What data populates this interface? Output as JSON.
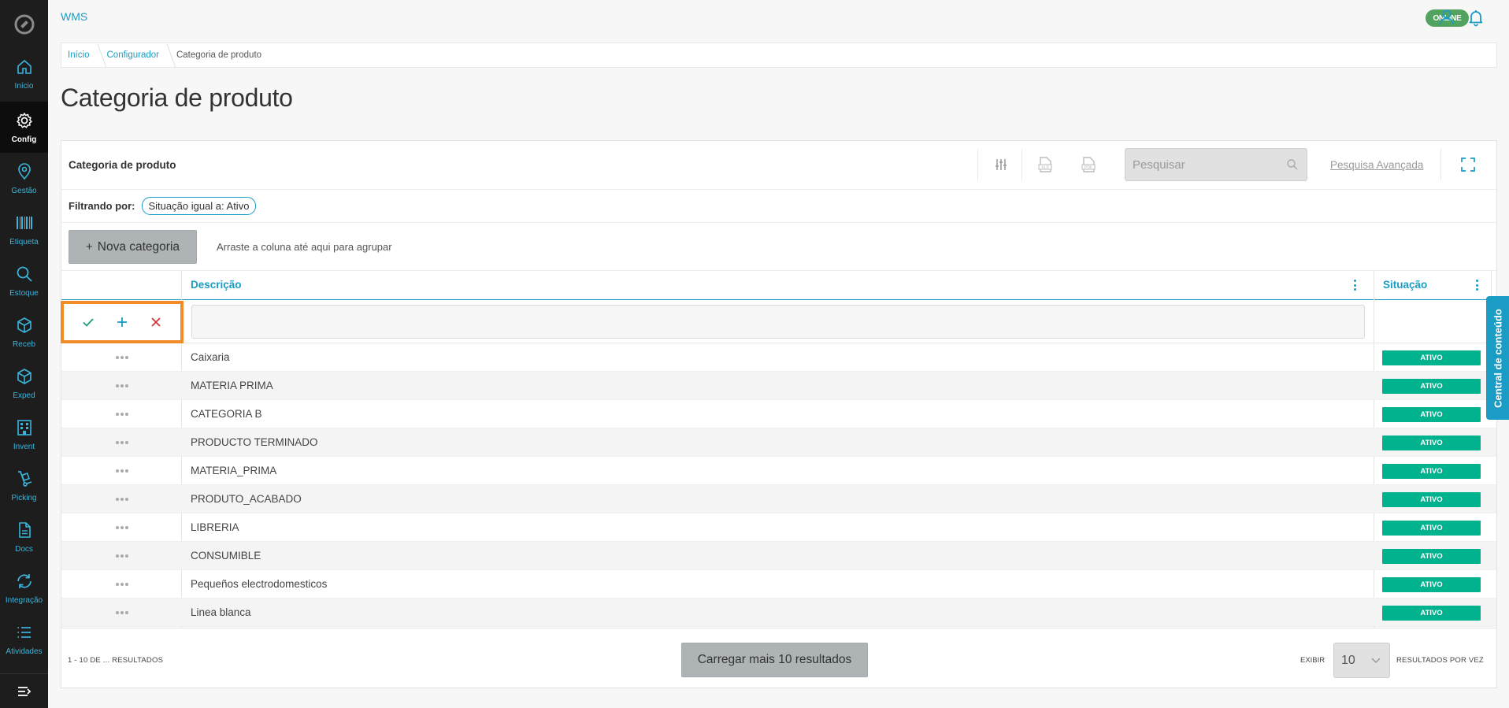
{
  "app": {
    "name": "WMS",
    "status": "ONLINE"
  },
  "sidebar": {
    "items": [
      {
        "label": "Início",
        "icon": "home-icon"
      },
      {
        "label": "Config",
        "icon": "gear-icon",
        "active": true
      },
      {
        "label": "Gestão",
        "icon": "location-pin-icon"
      },
      {
        "label": "Etiqueta",
        "icon": "barcode-icon"
      },
      {
        "label": "Estoque",
        "icon": "search-icon"
      },
      {
        "label": "Receb",
        "icon": "box-icon"
      },
      {
        "label": "Exped",
        "icon": "box-outline-icon"
      },
      {
        "label": "Invent",
        "icon": "building-icon"
      },
      {
        "label": "Picking",
        "icon": "hand-truck-icon"
      },
      {
        "label": "Docs",
        "icon": "document-icon"
      },
      {
        "label": "Integração",
        "icon": "sync-icon"
      },
      {
        "label": "Atividades",
        "icon": "list-icon"
      }
    ]
  },
  "breadcrumb": {
    "items": [
      "Início",
      "Configurador"
    ],
    "current": "Categoria de produto"
  },
  "page": {
    "title": "Categoria de produto"
  },
  "panel": {
    "title": "Categoria de produto",
    "search_placeholder": "Pesquisar",
    "advanced_search": "Pesquisa Avançada",
    "filter_label": "Filtrando por:",
    "filter_chip": "Situação igual a: Ativo",
    "new_button": "Nova categoria",
    "group_hint": "Arraste a coluna até aqui para agrupar"
  },
  "table": {
    "columns": [
      "Descrição",
      "Situação"
    ],
    "rows": [
      {
        "descricao": "Caixaria",
        "situacao": "ATIVO"
      },
      {
        "descricao": "MATERIA PRIMA",
        "situacao": "ATIVO"
      },
      {
        "descricao": "CATEGORIA B",
        "situacao": "ATIVO"
      },
      {
        "descricao": "PRODUCTO TERMINADO",
        "situacao": "ATIVO"
      },
      {
        "descricao": "MATERIA_PRIMA",
        "situacao": "ATIVO"
      },
      {
        "descricao": "PRODUTO_ACABADO",
        "situacao": "ATIVO"
      },
      {
        "descricao": "LIBRERIA",
        "situacao": "ATIVO"
      },
      {
        "descricao": "CONSUMIBLE",
        "situacao": "ATIVO"
      },
      {
        "descricao": "Pequeños electrodomesticos",
        "situacao": "ATIVO"
      },
      {
        "descricao": "Linea blanca",
        "situacao": "ATIVO"
      }
    ]
  },
  "footer": {
    "result_count": "1 - 10 DE ... RESULTADOS",
    "load_more": "Carregar mais 10 resultados",
    "show_label": "EXIBIR",
    "page_size": "10",
    "per_label": "RESULTADOS POR VEZ"
  },
  "side_tab": {
    "label": "Central de conteúdo"
  },
  "colors": {
    "accent": "#1a9cc4",
    "status": "#00b28e",
    "online": "#52a35f",
    "highlight": "#f28c28"
  }
}
